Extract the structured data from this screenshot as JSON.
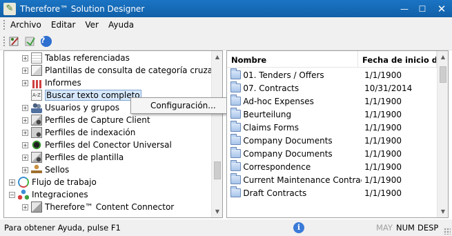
{
  "window": {
    "title": "Therefore™ Solution Designer"
  },
  "menu": {
    "items": [
      "Archivo",
      "Editar",
      "Ver",
      "Ayuda"
    ]
  },
  "tree": {
    "items": [
      {
        "label": "Tablas referenciadas",
        "icon": "table-icon",
        "expander": "+"
      },
      {
        "label": "Plantillas de consulta de categoría cruzada",
        "icon": "template-icon",
        "expander": "+"
      },
      {
        "label": "Informes",
        "icon": "report-icon",
        "expander": "+"
      },
      {
        "label": "Buscar texto completo",
        "icon": "fulltext-search-icon",
        "expander": "",
        "selected": true
      },
      {
        "label": "Usuarios y grupos",
        "icon": "users-icon",
        "expander": "+"
      },
      {
        "label": "Perfiles de Capture Client",
        "icon": "capture-client-icon",
        "expander": "+"
      },
      {
        "label": "Perfiles de indexación",
        "icon": "indexing-icon",
        "expander": "+"
      },
      {
        "label": "Perfiles del Conector Universal",
        "icon": "universal-connector-icon",
        "expander": "+"
      },
      {
        "label": "Perfiles de plantilla",
        "icon": "template-profile-icon",
        "expander": "+"
      },
      {
        "label": "Sellos",
        "icon": "stamp-icon",
        "expander": "+"
      },
      {
        "label": "Flujo de trabajo",
        "icon": "workflow-icon",
        "expander": "+"
      },
      {
        "label": "Integraciones",
        "icon": "integrations-icon",
        "expander": "−"
      },
      {
        "label": "Therefore™ Content Connector",
        "icon": "content-connector-icon",
        "expander": "+"
      }
    ]
  },
  "context_menu": {
    "items": [
      "Configuración..."
    ]
  },
  "list": {
    "columns": [
      "Nombre",
      "Fecha de inicio de ín"
    ],
    "rows": [
      {
        "name": "01. Tenders / Offers",
        "date": "1/1/1900"
      },
      {
        "name": "07. Contracts",
        "date": "10/31/2014"
      },
      {
        "name": "Ad-hoc Expenses",
        "date": "1/1/1900"
      },
      {
        "name": "Beurteilung",
        "date": "1/1/1900"
      },
      {
        "name": "Claims Forms",
        "date": "1/1/1900"
      },
      {
        "name": "Company Documents",
        "date": "1/1/1900"
      },
      {
        "name": "Company Documents",
        "date": "1/1/1900"
      },
      {
        "name": "Correspondence",
        "date": "1/1/1900"
      },
      {
        "name": "Current Maintenance Contracts",
        "date": "1/1/1900"
      },
      {
        "name": "Draft Contracts",
        "date": "1/1/1900"
      }
    ]
  },
  "status": {
    "text": "Para obtener Ayuda, pulse F1",
    "may": "MAY",
    "num": "NUM",
    "desp": "DESP"
  }
}
